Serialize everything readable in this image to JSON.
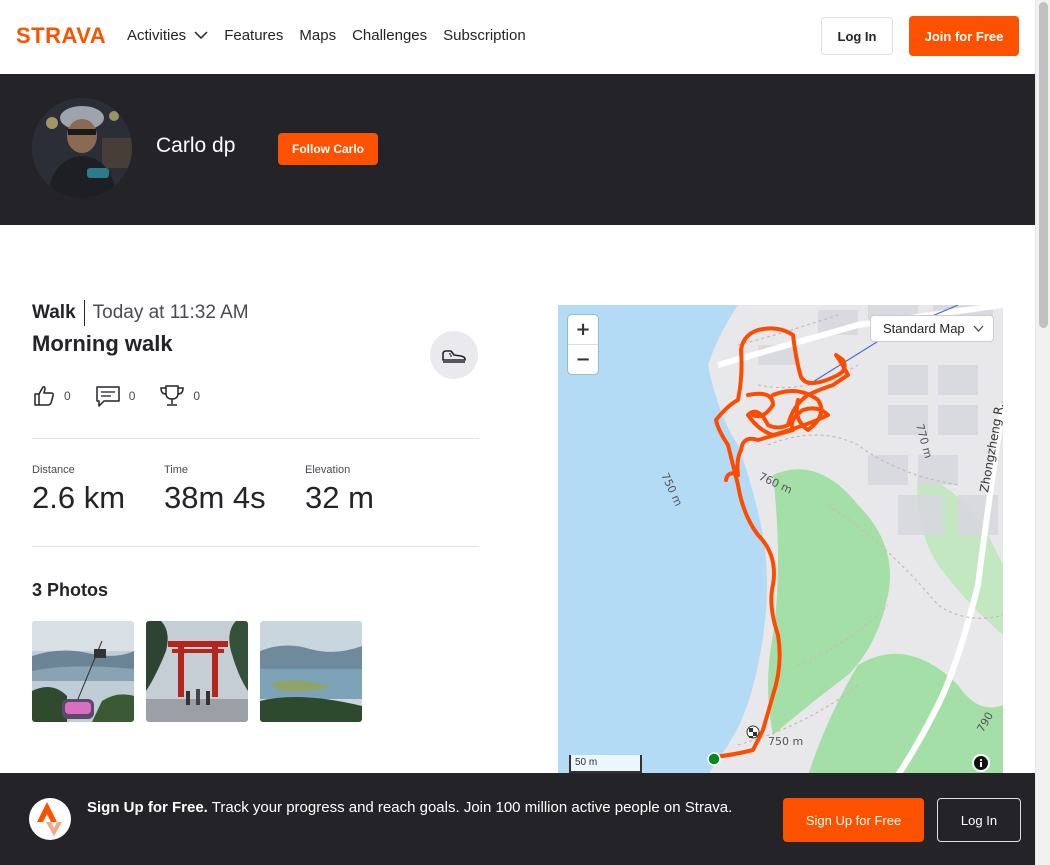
{
  "nav": {
    "logo_text": "STRAVA",
    "links": [
      "Activities",
      "Features",
      "Maps",
      "Challenges",
      "Subscription"
    ],
    "login_label": "Log In",
    "join_label": "Join for Free"
  },
  "athlete": {
    "name": "Carlo dp",
    "follow_label": "Follow Carlo"
  },
  "activity": {
    "type": "Walk",
    "date": "Today at 11:32 AM",
    "title": "Morning walk",
    "sport_icon": "shoe-icon",
    "kudos_count": "0",
    "comments_count": "0",
    "achievements_count": "0",
    "stats": [
      {
        "label": "Distance",
        "value": "2.6 km"
      },
      {
        "label": "Time",
        "value": "38m 4s"
      },
      {
        "label": "Elevation",
        "value": "32 m"
      }
    ]
  },
  "photos": {
    "title": "3 Photos",
    "count": 3
  },
  "map": {
    "style_label": "Standard Map",
    "scale_label": "50 m",
    "route_color": "#fc4c02",
    "contour_labels": [
      "750 m",
      "760 m",
      "770 m",
      "790",
      "750 m"
    ],
    "street_label": "Zhongzheng R...",
    "street_label2": "Zhongzheng Rd"
  },
  "banner": {
    "headline": "Sign Up for Free.",
    "text": "Track your progress and reach goals. Join 100 million active people on Strava.",
    "signup_label": "Sign Up for Free",
    "login_label": "Log In"
  },
  "colors": {
    "brand": "#fc5200",
    "dark": "#242428"
  }
}
